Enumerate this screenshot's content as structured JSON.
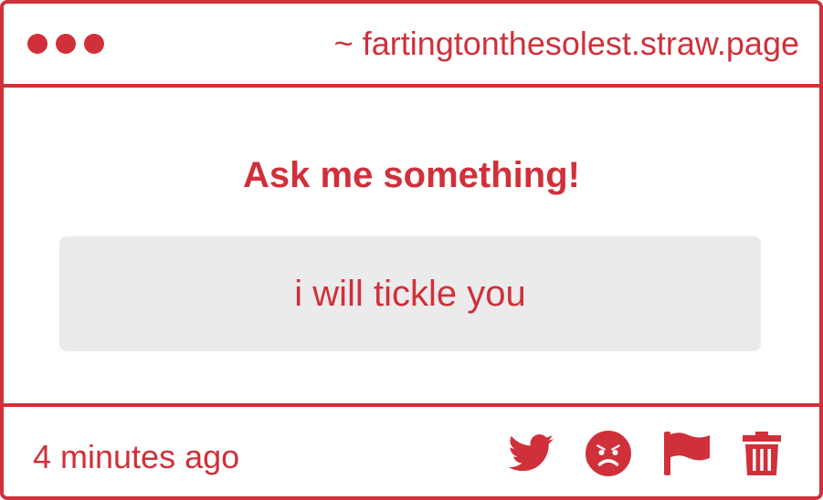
{
  "window": {
    "url": "~ fartingtonthesolest.straw.page"
  },
  "main": {
    "heading": "Ask me something!",
    "question": "i will tickle you"
  },
  "footer": {
    "timestamp": "4 minutes ago",
    "actions": [
      {
        "icon": "twitter-icon",
        "label": "share on twitter"
      },
      {
        "icon": "angry-face-icon",
        "label": "block"
      },
      {
        "icon": "flag-icon",
        "label": "report"
      },
      {
        "icon": "trash-icon",
        "label": "delete"
      }
    ]
  },
  "colors": {
    "accent": "#d0303a",
    "question_background": "#ecebec",
    "background": "#ffffff"
  }
}
